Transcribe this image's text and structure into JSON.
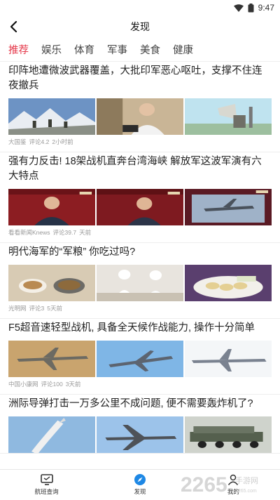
{
  "status": {
    "time": "9:47"
  },
  "header": {
    "title": "发现"
  },
  "tabs": [
    {
      "label": "推荐",
      "active": true
    },
    {
      "label": "娱乐"
    },
    {
      "label": "体育"
    },
    {
      "label": "军事"
    },
    {
      "label": "美食"
    },
    {
      "label": "健康"
    }
  ],
  "articles": [
    {
      "title": "印阵地遭微波武器覆盖，大批印军恶心呕吐，支撑不住连夜撤兵",
      "source": "大国鉴",
      "comments": "评论4.2",
      "time": "2小时前"
    },
    {
      "title": "强有力反击! 18架战机直奔台湾海峡 解放军这波军演有六大特点",
      "source": "看看新闻Knews",
      "comments": "评论39.7",
      "time": "天前"
    },
    {
      "title": "明代海军的“军粮” 你吃过吗?",
      "source": "光明网",
      "comments": "评论3",
      "time": "5天前"
    },
    {
      "title": "F5超音速轻型战机, 具备全天候作战能力, 操作十分简单",
      "source": "中国小康网",
      "comments": "评论100",
      "time": "3天前"
    },
    {
      "title": "洲际导弹打击一万多公里不成问题, 便不需要轰炸机了?",
      "source": "",
      "comments": "",
      "time": ""
    }
  ],
  "nav": [
    {
      "label": "航班查询",
      "icon": "monitor-icon"
    },
    {
      "label": "发现",
      "icon": "compass-icon",
      "active": true
    },
    {
      "label": "我的",
      "icon": "user-icon"
    }
  ],
  "watermark": {
    "text": "2265",
    "sub": "手游网",
    "domain": "2265.com"
  },
  "colors": {
    "accent": "#e5384a",
    "nav_active": "#1e88e5"
  }
}
